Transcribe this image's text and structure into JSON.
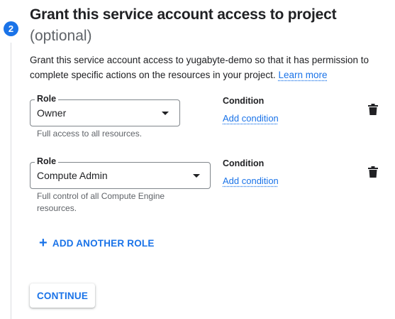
{
  "step": {
    "number": "2",
    "title": "Grant this service account access to project",
    "subtitle": "(optional)"
  },
  "description": {
    "line1": "Grant this service account access to yugabyte-demo so that it has permission to",
    "line2": "complete specific actions on the resources in your project.",
    "learn_more": "Learn more"
  },
  "roles": [
    {
      "label": "Role",
      "value": "Owner",
      "hint": "Full access to all resources.",
      "condition_label": "Condition",
      "condition_link": "Add condition",
      "delete_icon": "trash-icon"
    },
    {
      "label": "Role",
      "value": "Compute Admin",
      "hint_line1": "Full control of all Compute Engine",
      "hint_line2": "resources.",
      "condition_label": "Condition",
      "condition_link": "Add condition",
      "delete_icon": "trash-icon"
    }
  ],
  "add_role": {
    "icon": "plus-icon",
    "label": "ADD ANOTHER ROLE"
  },
  "continue_label": "CONTINUE",
  "colors": {
    "accent": "#1a73e8",
    "text": "#202124",
    "secondary_text": "#5f6368",
    "border": "#80868b"
  }
}
